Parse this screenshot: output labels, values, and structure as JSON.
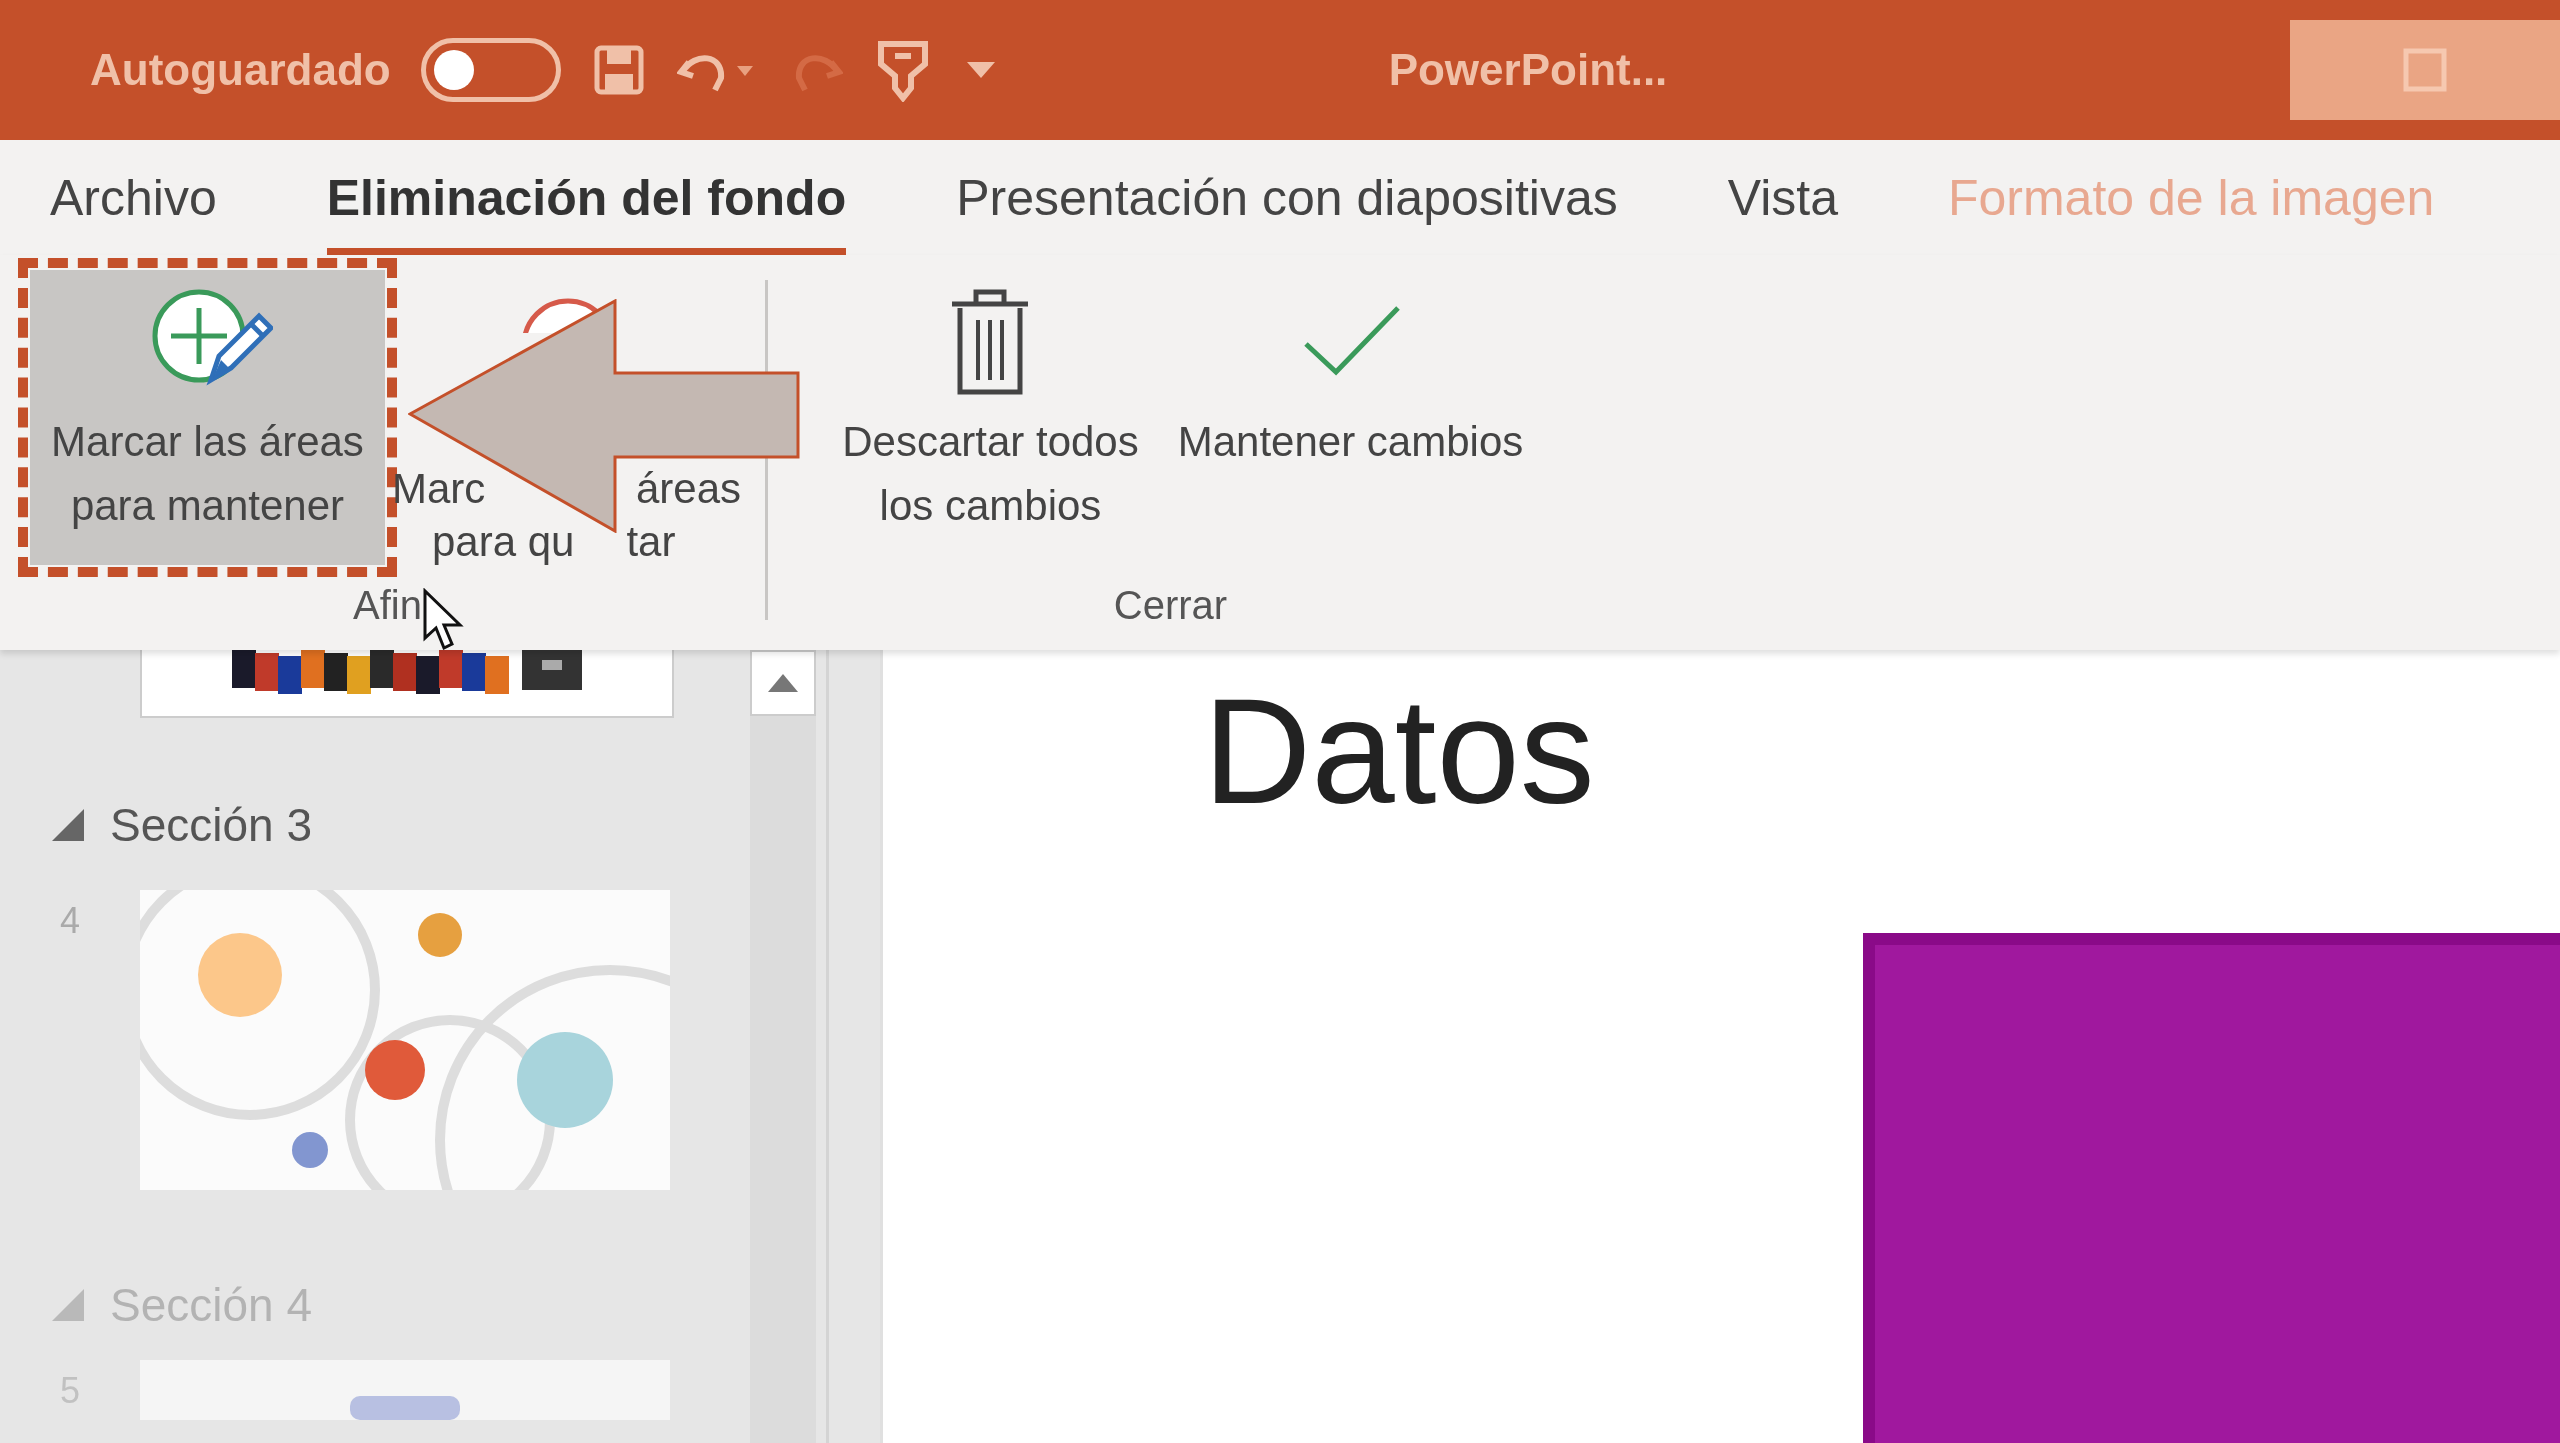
{
  "title_bar": {
    "autosave_label": "Autoguardado",
    "autosave_on": false,
    "document_title": "PowerPoint..."
  },
  "tabs": [
    {
      "label": "Archivo",
      "selected": false,
      "kind": "normal"
    },
    {
      "label": "Eliminación del fondo",
      "selected": true,
      "kind": "normal"
    },
    {
      "label": "Presentación con diapositivas",
      "selected": false,
      "kind": "normal"
    },
    {
      "label": "Vista",
      "selected": false,
      "kind": "normal"
    },
    {
      "label": "Formato de la imagen",
      "selected": false,
      "kind": "contextual"
    }
  ],
  "ribbon_groups": [
    {
      "label": "Afin",
      "buttons": [
        {
          "label": "Marcar las áreas para mantener",
          "kind": "keep",
          "selected": true,
          "highlighted": true
        },
        {
          "label_lines": [
            [
              "Marc",
              "áreas"
            ],
            [
              "para qu",
              "tar"
            ]
          ],
          "kind": "remove",
          "selected": false,
          "highlighted": false
        }
      ]
    },
    {
      "label": "Cerrar",
      "buttons": [
        {
          "label": "Descartar todos los cambios",
          "kind": "discard",
          "selected": false,
          "highlighted": false
        },
        {
          "label": "Mantener cambios",
          "kind": "accept",
          "selected": false,
          "highlighted": false
        }
      ]
    }
  ],
  "slides_pane": {
    "sections": [
      {
        "title": "Sección 3",
        "expanded": true,
        "slides": [
          {
            "number": "4",
            "kind": "picture"
          }
        ]
      },
      {
        "title": "Sección 4",
        "expanded": true,
        "slides": [
          {
            "number": "5",
            "kind": "picture"
          }
        ]
      }
    ]
  },
  "slide": {
    "title": "Datos"
  }
}
